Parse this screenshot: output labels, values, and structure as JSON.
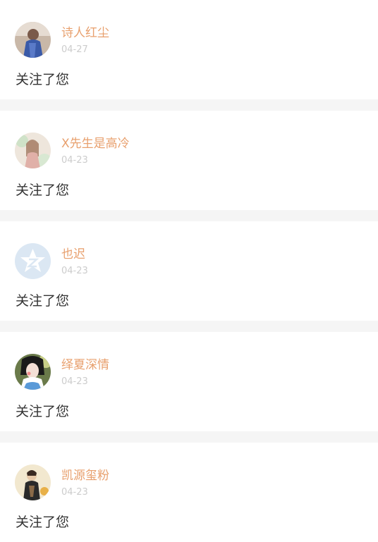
{
  "follows": [
    {
      "name": "诗人红尘",
      "date": "04-27",
      "message": "关注了您",
      "avatar_icon": "user-avatar-icon"
    },
    {
      "name": "X先生是高冷",
      "date": "04-23",
      "message": "关注了您",
      "avatar_icon": "user-avatar-icon"
    },
    {
      "name": "也迟",
      "date": "04-23",
      "message": "关注了您",
      "avatar_icon": "default-qq-avatar-icon"
    },
    {
      "name": "绎夏深情",
      "date": "04-23",
      "message": "关注了您",
      "avatar_icon": "user-avatar-icon"
    },
    {
      "name": "凯源玺粉",
      "date": "04-23",
      "message": "关注了您",
      "avatar_icon": "user-avatar-icon"
    }
  ],
  "colors": {
    "name": "#e8a06e",
    "date": "#cccccc",
    "message": "#333333",
    "accent": "#ef6c9a",
    "background": "#f5f5f5"
  }
}
